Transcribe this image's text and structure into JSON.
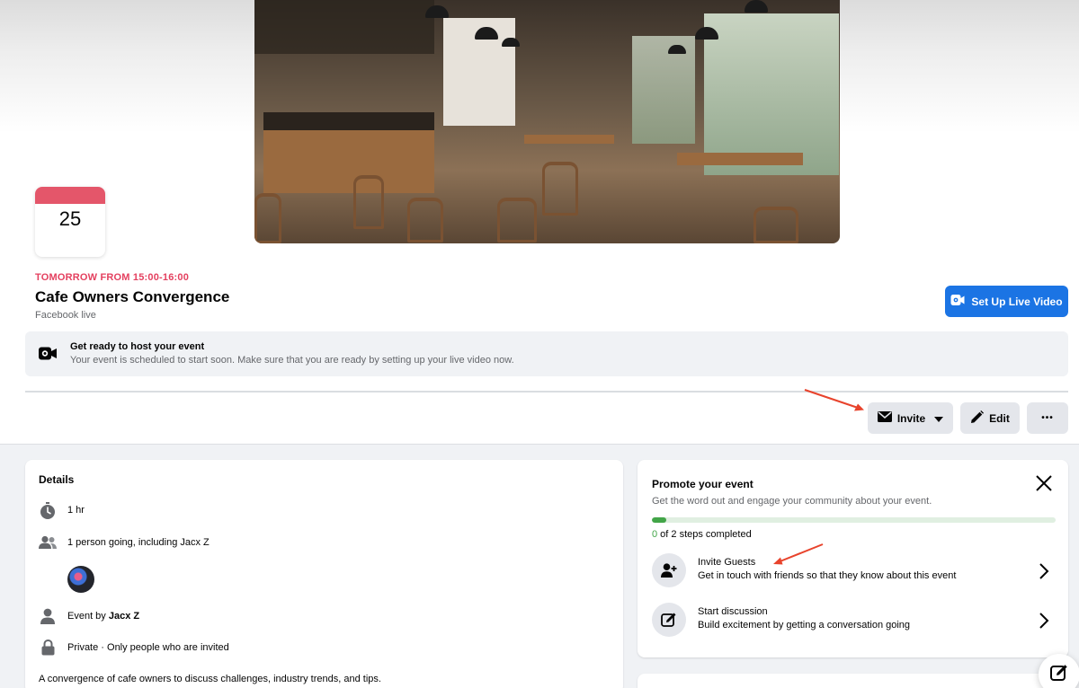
{
  "calendar": {
    "day": "25"
  },
  "event": {
    "time": "TOMORROW FROM 15:00-16:00",
    "title": "Cafe Owners Convergence",
    "subtitle": "Facebook live"
  },
  "live_button": {
    "label": "Set Up Live Video",
    "icon": "video-camera-icon"
  },
  "notice": {
    "icon": "video-camera-icon",
    "title": "Get ready to host your event",
    "text": "Your event is scheduled to start soon. Make sure that you are ready by setting up your live video now."
  },
  "actions": {
    "invite_label": "Invite",
    "edit_label": "Edit",
    "more_label": "•••"
  },
  "details": {
    "title": "Details",
    "duration": "1 hr",
    "going": "1 person going, including Jacx Z",
    "event_by_prefix": "Event by ",
    "event_by_name": "Jacx Z",
    "privacy": "Private · Only people who are invited",
    "description": "A convergence of cafe owners to discuss challenges, industry trends, and tips."
  },
  "promote": {
    "title": "Promote your event",
    "subtitle": "Get the word out and engage your community about your event.",
    "progress_fraction": 0.0,
    "steps_done": "0",
    "steps_text": " of 2 steps completed",
    "tasks": [
      {
        "title": "Invite Guests",
        "subtitle": "Get in touch with friends so that they know about this event",
        "icon": "add-person-icon"
      },
      {
        "title": "Start discussion",
        "subtitle": "Build excitement by getting a conversation going",
        "icon": "compose-icon"
      }
    ]
  },
  "colors": {
    "accent": "#1b74e4",
    "date_red": "#e4405f",
    "progress_green": "#42a548",
    "annotation_arrow": "#e8432c"
  }
}
